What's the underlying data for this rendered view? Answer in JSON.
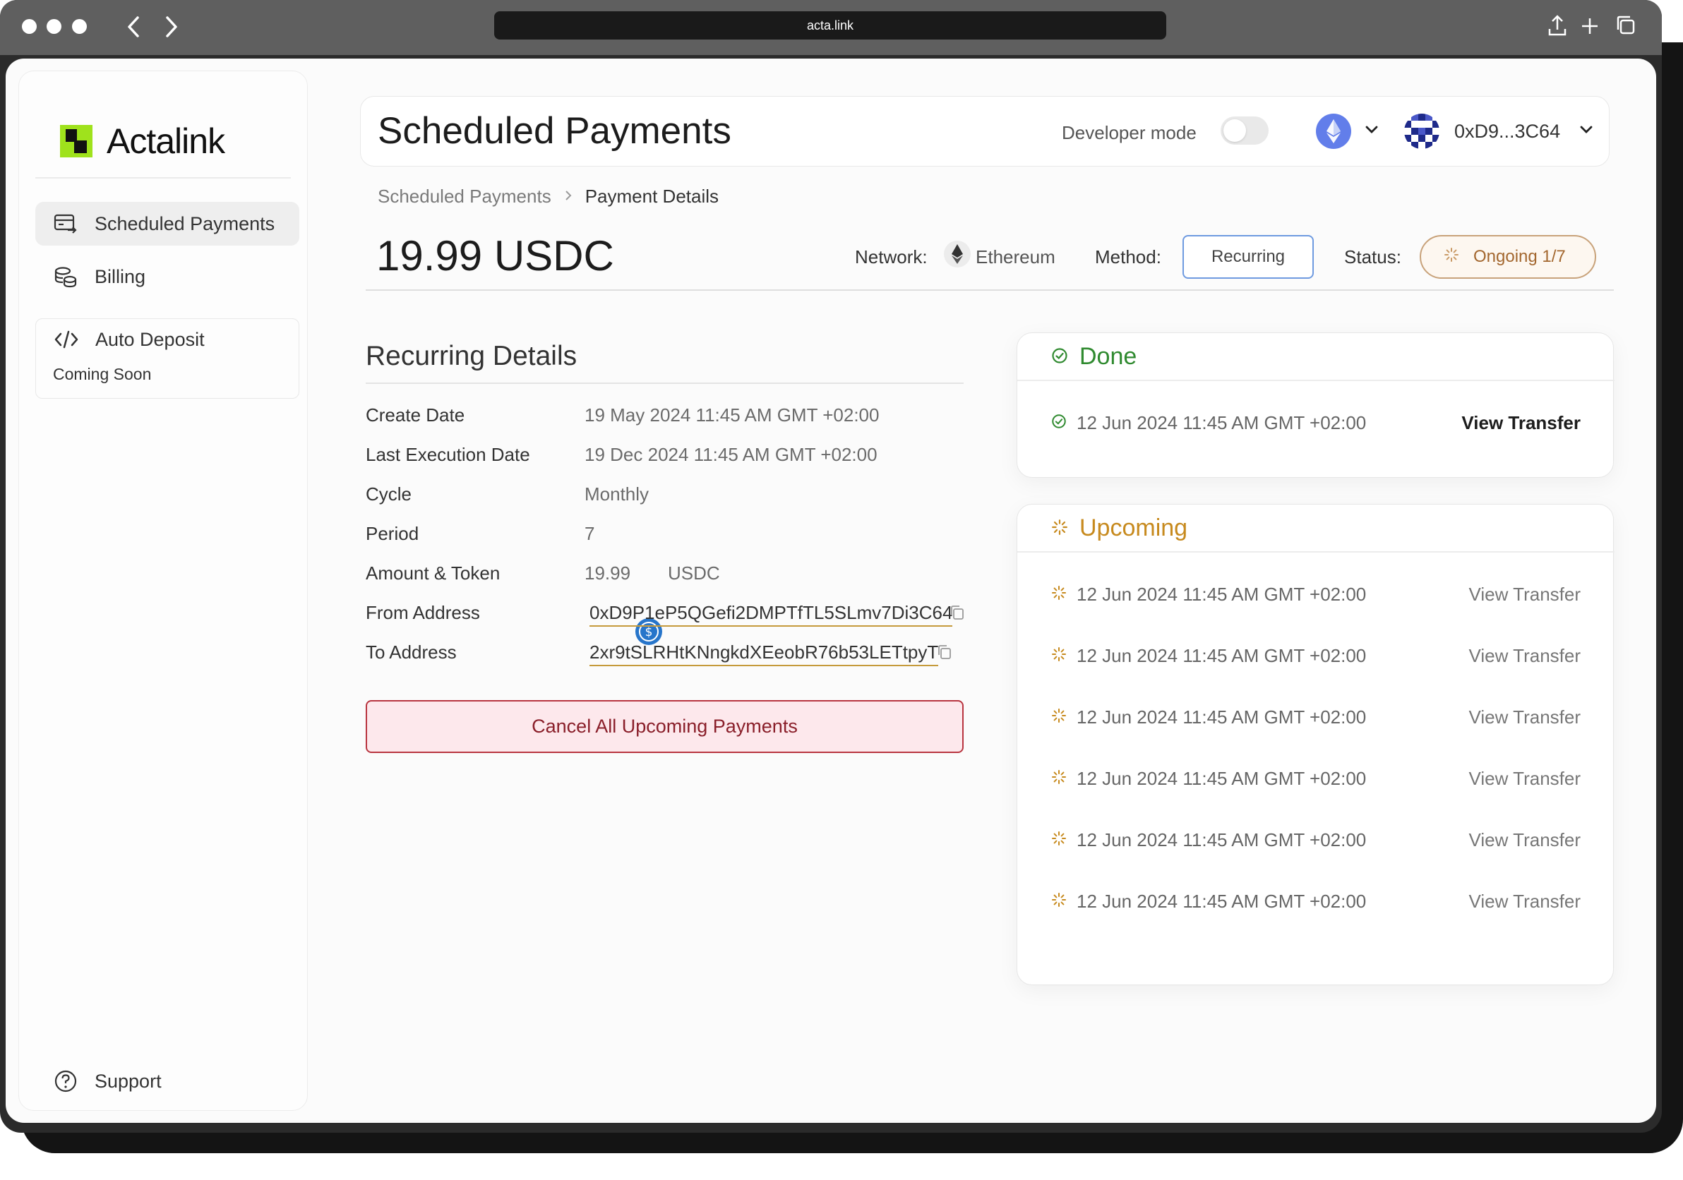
{
  "browser": {
    "url": "acta.link"
  },
  "sidebar": {
    "brand": "Actalink",
    "items": [
      {
        "label": "Scheduled Payments",
        "icon": "card-transfer-icon",
        "active": true
      },
      {
        "label": "Billing",
        "icon": "coins-icon"
      },
      {
        "label": "Auto Deposit",
        "icon": "code-icon",
        "note": "Coming Soon"
      }
    ],
    "support": {
      "label": "Support",
      "icon": "help-circle-icon"
    }
  },
  "header": {
    "title": "Scheduled Payments",
    "developer_mode_label": "Developer mode",
    "developer_mode_on": false,
    "wallet_address": "0xD9...3C64"
  },
  "breadcrumb": {
    "parent": "Scheduled Payments",
    "current": "Payment Details"
  },
  "payment": {
    "amount": "19.99 USDC",
    "network_label": "Network:",
    "network": "Ethereum",
    "method_label": "Method:",
    "method": "Recurring",
    "status_label": "Status:",
    "status": "Ongoing 1/7"
  },
  "details": {
    "title": "Recurring Details",
    "rows": [
      {
        "label": "Create Date",
        "value": "19 May 2024 11:45 AM GMT +02:00"
      },
      {
        "label": "Last Execution Date",
        "value": "19 Dec 2024 11:45 AM GMT +02:00"
      },
      {
        "label": "Cycle",
        "value": "Monthly"
      },
      {
        "label": "Period",
        "value": "7"
      },
      {
        "label": "Amount & Token",
        "value": "19.99",
        "token": "USDC"
      },
      {
        "label": "From Address",
        "value": "0xD9P1eP5QGefi2DMPTfTL5SLmv7Di3C64"
      },
      {
        "label": "To Address",
        "value": "2xr9tSLRHtKNngkdXEeobR76b53LETtpyT"
      }
    ],
    "cancel_button": "Cancel All Upcoming Payments"
  },
  "done": {
    "title": "Done",
    "items": [
      {
        "date": "12 Jun 2024 11:45 AM GMT +02:00",
        "action": "View Transfer"
      }
    ]
  },
  "upcoming": {
    "title": "Upcoming",
    "items": [
      {
        "date": "12 Jun 2024 11:45 AM GMT +02:00",
        "action": "View Transfer"
      },
      {
        "date": "12 Jun 2024 11:45 AM GMT +02:00",
        "action": "View Transfer"
      },
      {
        "date": "12 Jun 2024 11:45 AM GMT +02:00",
        "action": "View Transfer"
      },
      {
        "date": "12 Jun 2024 11:45 AM GMT +02:00",
        "action": "View Transfer"
      },
      {
        "date": "12 Jun 2024 11:45 AM GMT +02:00",
        "action": "View Transfer"
      },
      {
        "date": "12 Jun 2024 11:45 AM GMT +02:00",
        "action": "View Transfer"
      }
    ]
  },
  "colors": {
    "done": "#2f8a2f",
    "upcoming": "#c78a1e",
    "cancel_border": "#b8343f",
    "method_border": "#6e9ae0",
    "brand_green": "#9fe21c"
  }
}
